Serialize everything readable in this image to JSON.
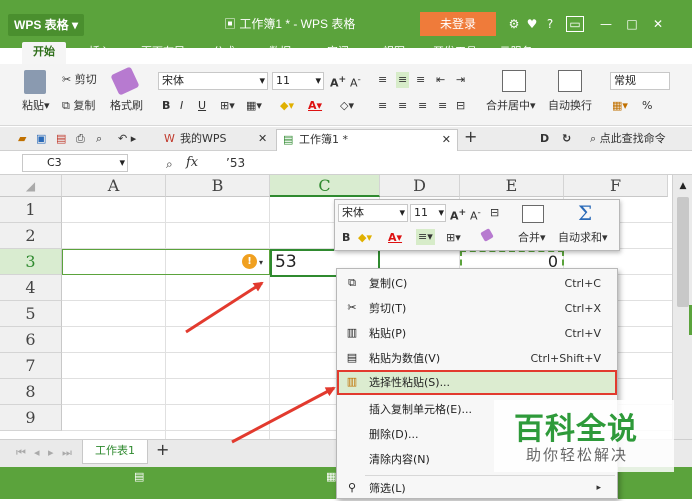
{
  "app": {
    "logo": "WPS 表格",
    "doc_title": "工作簿1 * - WPS 表格",
    "login": "未登录",
    "help": "?"
  },
  "tabs": [
    "开始",
    "插入",
    "页面布局",
    "公式",
    "数据",
    "审阅",
    "视图",
    "开发工具",
    "云服务"
  ],
  "ribbon": {
    "paste": "粘贴",
    "cut": "剪切",
    "copy": "复制",
    "format_painter": "格式刷",
    "font_name": "宋体",
    "font_size": "11",
    "merge_center": "合并居中",
    "wrap": "自动换行",
    "number_format": "常规",
    "percent": "%"
  },
  "doctabs": {
    "my_wps": "我的WPS",
    "workbook": "工作簿1 *",
    "find_cmd": "点此查找命令"
  },
  "formula_bar": {
    "name_box": "C3",
    "fx": "fx",
    "content": "’53"
  },
  "grid": {
    "columns": [
      "A",
      "B",
      "C",
      "D",
      "E",
      "F"
    ],
    "rows": [
      "1",
      "2",
      "3",
      "4",
      "5",
      "6",
      "7",
      "8",
      "9"
    ],
    "c3": "53",
    "e3": "0"
  },
  "sheet": {
    "name": "工作表1",
    "add": "+"
  },
  "mini_toolbar": {
    "font_name": "宋体",
    "font_size": "11",
    "merge": "合并",
    "autosum": "自动求和"
  },
  "context_menu": [
    {
      "label": "复制(C)",
      "shortcut": "Ctrl+C",
      "icon": "copy-icon"
    },
    {
      "label": "剪切(T)",
      "shortcut": "Ctrl+X",
      "icon": "scissors-icon"
    },
    {
      "label": "粘贴(P)",
      "shortcut": "Ctrl+V",
      "icon": "clipboard-icon"
    },
    {
      "label": "粘贴为数值(V)",
      "shortcut": "Ctrl+Shift+V",
      "icon": "paste-values-icon"
    },
    {
      "label": "选择性粘贴(S)...",
      "shortcut": "",
      "icon": "paste-special-icon"
    },
    {
      "label": "插入复制单元格(E)...",
      "shortcut": "",
      "icon": ""
    },
    {
      "label": "删除(D)...",
      "shortcut": "",
      "icon": ""
    },
    {
      "label": "清除内容(N)",
      "shortcut": "",
      "icon": ""
    },
    {
      "label": "筛选(L)",
      "shortcut": "",
      "icon": "filter-icon"
    }
  ],
  "watermark": {
    "title": "百科全说",
    "subtitle": "助你轻松解决"
  },
  "colors": {
    "brand_green": "#5ba33c",
    "login_orange": "#ef7b3a",
    "annotation_red": "#e23a2e",
    "selection_green": "#2f8a2f"
  }
}
